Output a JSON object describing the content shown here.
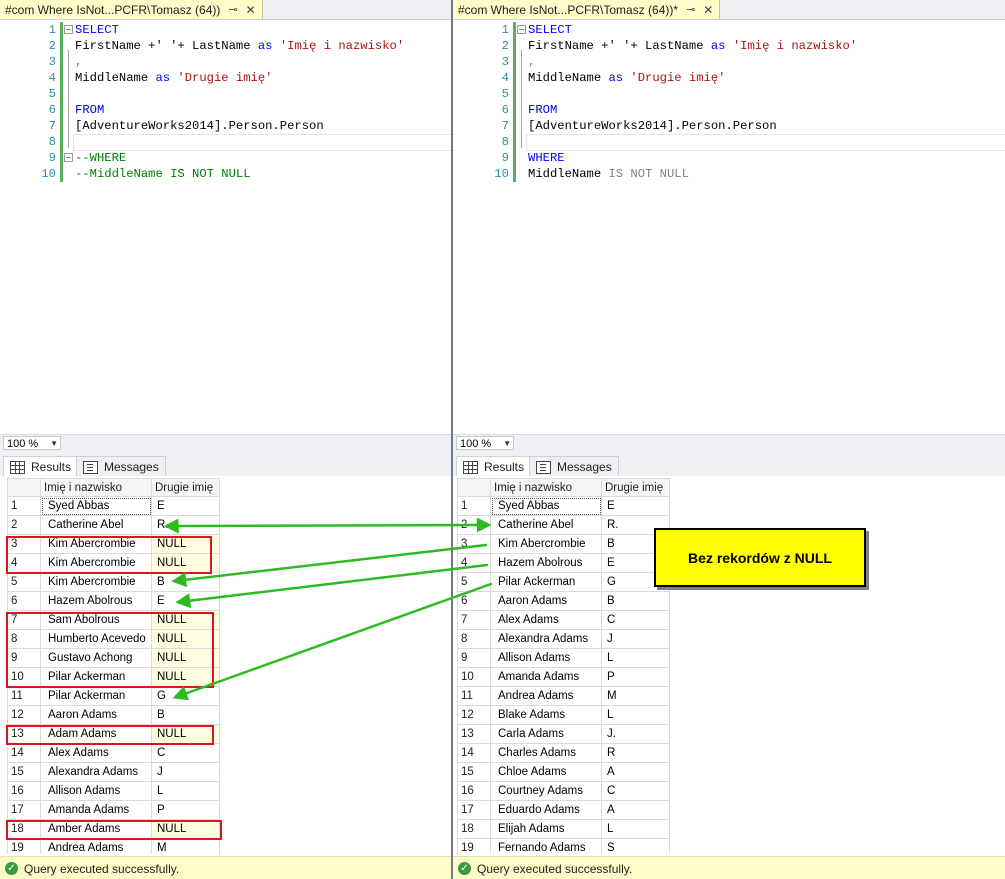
{
  "left": {
    "tab_title": "#com Where IsNot...PCFR\\Tomasz (64))",
    "zoom": "100 %",
    "code_lines": [
      {
        "n": "1",
        "parts": [
          {
            "t": "SELECT",
            "c": "kw"
          }
        ]
      },
      {
        "n": "2",
        "parts": [
          {
            "t": "FirstName +' '+ LastName ",
            "c": ""
          },
          {
            "t": "as",
            "c": "kw"
          },
          {
            "t": " ",
            "c": ""
          },
          {
            "t": "'Imię i nazwisko'",
            "c": "str"
          }
        ]
      },
      {
        "n": "3",
        "parts": [
          {
            "t": ",",
            "c": "gray"
          }
        ]
      },
      {
        "n": "4",
        "parts": [
          {
            "t": "MiddleName ",
            "c": ""
          },
          {
            "t": "as",
            "c": "kw"
          },
          {
            "t": " ",
            "c": ""
          },
          {
            "t": "'Drugie imię'",
            "c": "str"
          }
        ]
      },
      {
        "n": "5",
        "parts": []
      },
      {
        "n": "6",
        "parts": [
          {
            "t": "FROM",
            "c": "kw"
          }
        ]
      },
      {
        "n": "7",
        "parts": [
          {
            "t": "[AdventureWorks2014].Person.Person",
            "c": ""
          }
        ]
      },
      {
        "n": "8",
        "parts": []
      },
      {
        "n": "9",
        "parts": [
          {
            "t": "--WHERE",
            "c": "cmt"
          }
        ]
      },
      {
        "n": "10",
        "parts": [
          {
            "t": "--MiddleName IS NOT NULL",
            "c": "cmt"
          }
        ]
      }
    ],
    "results_tab": "Results",
    "messages_tab": "Messages",
    "columns": [
      "Imię i nazwisko",
      "Drugie imię"
    ],
    "rows": [
      [
        "1",
        "Syed Abbas",
        "E"
      ],
      [
        "2",
        "Catherine Abel",
        "R."
      ],
      [
        "3",
        "Kim Abercrombie",
        "NULL"
      ],
      [
        "4",
        "Kim Abercrombie",
        "NULL"
      ],
      [
        "5",
        "Kim Abercrombie",
        "B"
      ],
      [
        "6",
        "Hazem Abolrous",
        "E"
      ],
      [
        "7",
        "Sam Abolrous",
        "NULL"
      ],
      [
        "8",
        "Humberto Acevedo",
        "NULL"
      ],
      [
        "9",
        "Gustavo Achong",
        "NULL"
      ],
      [
        "10",
        "Pilar Ackerman",
        "NULL"
      ],
      [
        "11",
        "Pilar Ackerman",
        "G"
      ],
      [
        "12",
        "Aaron Adams",
        "B"
      ],
      [
        "13",
        "Adam Adams",
        "NULL"
      ],
      [
        "14",
        "Alex Adams",
        "C"
      ],
      [
        "15",
        "Alexandra Adams",
        "J"
      ],
      [
        "16",
        "Allison Adams",
        "L"
      ],
      [
        "17",
        "Amanda Adams",
        "P"
      ],
      [
        "18",
        "Amber Adams",
        "NULL"
      ],
      [
        "19",
        "Andrea Adams",
        "M"
      ]
    ],
    "status": "Query executed successfully."
  },
  "right": {
    "tab_title": "#com Where IsNot...PCFR\\Tomasz (64))*",
    "zoom": "100 %",
    "code_lines": [
      {
        "n": "1",
        "parts": [
          {
            "t": "SELECT",
            "c": "kw"
          }
        ]
      },
      {
        "n": "2",
        "parts": [
          {
            "t": "FirstName +' '+ LastName ",
            "c": ""
          },
          {
            "t": "as",
            "c": "kw"
          },
          {
            "t": " ",
            "c": ""
          },
          {
            "t": "'Imię i nazwisko'",
            "c": "str"
          }
        ]
      },
      {
        "n": "3",
        "parts": [
          {
            "t": ",",
            "c": "gray"
          }
        ]
      },
      {
        "n": "4",
        "parts": [
          {
            "t": "MiddleName ",
            "c": ""
          },
          {
            "t": "as",
            "c": "kw"
          },
          {
            "t": " ",
            "c": ""
          },
          {
            "t": "'Drugie imię'",
            "c": "str"
          }
        ]
      },
      {
        "n": "5",
        "parts": []
      },
      {
        "n": "6",
        "parts": [
          {
            "t": "FROM",
            "c": "kw"
          }
        ]
      },
      {
        "n": "7",
        "parts": [
          {
            "t": "[AdventureWorks2014].Person.Person",
            "c": ""
          }
        ]
      },
      {
        "n": "8",
        "parts": []
      },
      {
        "n": "9",
        "parts": [
          {
            "t": "WHERE",
            "c": "kw"
          }
        ]
      },
      {
        "n": "10",
        "parts": [
          {
            "t": "MiddleName ",
            "c": ""
          },
          {
            "t": "IS NOT NULL",
            "c": "gray"
          }
        ]
      }
    ],
    "results_tab": "Results",
    "messages_tab": "Messages",
    "columns": [
      "Imię i nazwisko",
      "Drugie imię"
    ],
    "rows": [
      [
        "1",
        "Syed Abbas",
        "E"
      ],
      [
        "2",
        "Catherine Abel",
        "R."
      ],
      [
        "3",
        "Kim Abercrombie",
        "B"
      ],
      [
        "4",
        "Hazem Abolrous",
        "E"
      ],
      [
        "5",
        "Pilar Ackerman",
        "G"
      ],
      [
        "6",
        "Aaron Adams",
        "B"
      ],
      [
        "7",
        "Alex Adams",
        "C"
      ],
      [
        "8",
        "Alexandra Adams",
        "J"
      ],
      [
        "9",
        "Allison Adams",
        "L"
      ],
      [
        "10",
        "Amanda Adams",
        "P"
      ],
      [
        "11",
        "Andrea Adams",
        "M"
      ],
      [
        "12",
        "Blake Adams",
        "L"
      ],
      [
        "13",
        "Carla Adams",
        "J."
      ],
      [
        "14",
        "Charles Adams",
        "R"
      ],
      [
        "15",
        "Chloe Adams",
        "A"
      ],
      [
        "16",
        "Courtney Adams",
        "C"
      ],
      [
        "17",
        "Eduardo Adams",
        "A"
      ],
      [
        "18",
        "Elijah Adams",
        "L"
      ],
      [
        "19",
        "Fernando Adams",
        "S"
      ]
    ],
    "status": "Query executed successfully."
  },
  "callout": {
    "text": "Bez rekordów z NULL",
    "background": "#ffff00"
  },
  "colors": {
    "highlight_box": "#e0141e",
    "arrow": "#2dbb1f",
    "status_bg": "#fefcc8"
  }
}
